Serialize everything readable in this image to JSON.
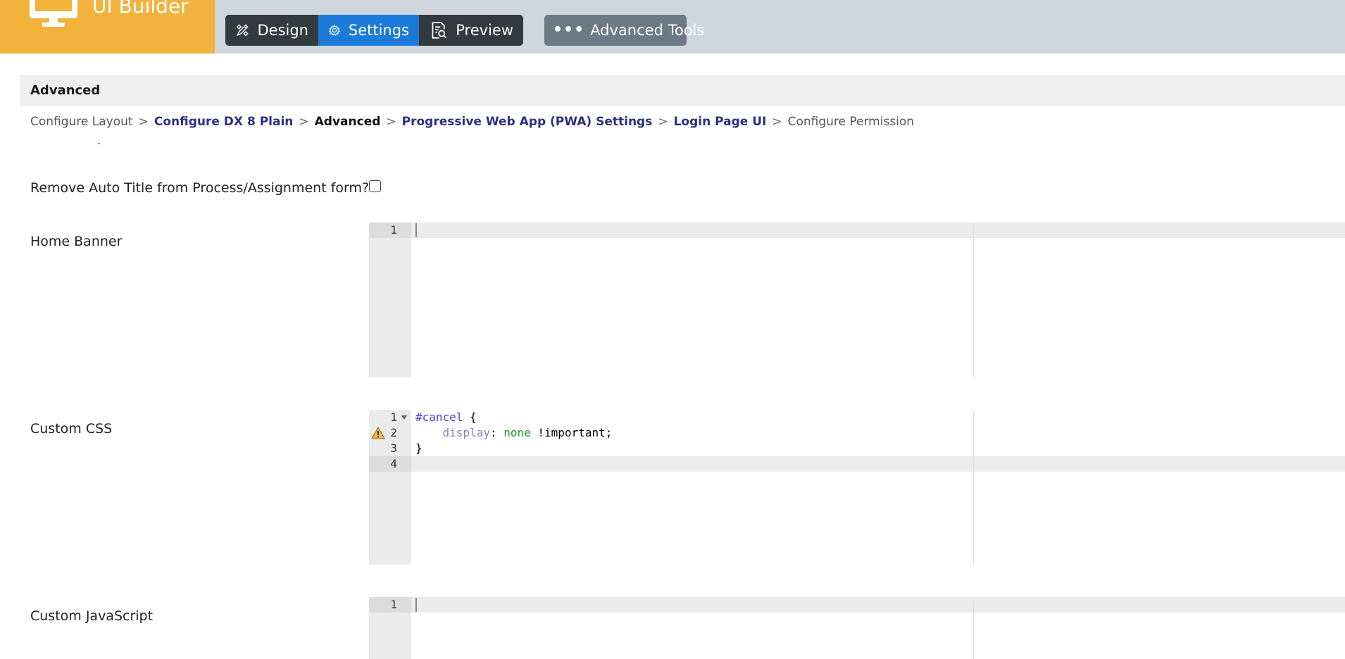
{
  "app": {
    "title": "UI Builder",
    "brand_icon": "monitor-icon",
    "colors": {
      "brand": "#f2b33d",
      "active_tab": "#1c7bd8",
      "link": "#2c3080"
    }
  },
  "modes": [
    {
      "label": "Design",
      "icon": "design-tools-icon",
      "active": false
    },
    {
      "label": "Settings",
      "icon": "gear-icon",
      "active": true
    },
    {
      "label": "Preview",
      "icon": "preview-document-icon",
      "active": false
    }
  ],
  "advanced_tools": {
    "label": "Advanced Tools",
    "icon": "more-dots-icon"
  },
  "section": {
    "title": "Advanced"
  },
  "breadcrumb": [
    "Configure Layout",
    "Configure DX 8 Plain",
    "Advanced",
    "Progressive Web App (PWA) Settings",
    "Login Page UI",
    "Configure Permission"
  ],
  "breadcrumb_separator": ">",
  "stray_text": ".",
  "fields": {
    "remove_auto_title": {
      "label": "Remove Auto Title from Process/Assignment form?",
      "checked": false
    },
    "home_banner": {
      "label": "Home Banner",
      "lines": [
        "1"
      ]
    },
    "custom_css": {
      "label": "Custom CSS",
      "line_numbers": [
        "1",
        "2",
        "3",
        "4"
      ],
      "code": {
        "l1_selector": "#cancel",
        "l1_brace": " {",
        "l2_indent": "    ",
        "l2_prop": "display",
        "l2_colon": ": ",
        "l2_value": "none",
        "l2_rest": " !important;",
        "l3": "}"
      },
      "warning_icon": "warning-triangle-icon"
    },
    "custom_javascript": {
      "label": "Custom JavaScript",
      "lines": [
        "1"
      ]
    }
  }
}
